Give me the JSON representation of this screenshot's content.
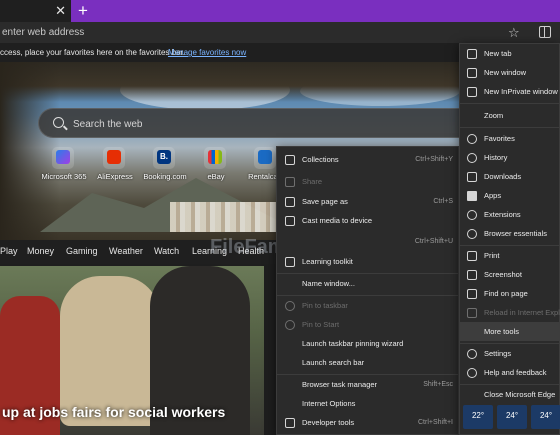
{
  "tabstrip": {
    "close_glyph": "✕",
    "newtab_glyph": "+"
  },
  "address": {
    "text": "enter web address"
  },
  "favbar": {
    "message": "ccess, place your favorites here on the favorites bar.",
    "link": "Manage favorites now"
  },
  "search": {
    "placeholder": "Search the web"
  },
  "quicklinks": [
    {
      "label": "Microsoft 365",
      "icon": "microsoft365-icon",
      "color": "#5a4bd1"
    },
    {
      "label": "AliExpress",
      "icon": "aliexpress-icon",
      "color": "#e62e04"
    },
    {
      "label": "Booking.com",
      "icon": "booking-icon",
      "color": "#003580"
    },
    {
      "label": "eBay",
      "icon": "ebay-icon",
      "color": "#e53238"
    },
    {
      "label": "Rentalcars",
      "icon": "rentalcars-icon",
      "color": "#1b6bc4"
    }
  ],
  "quicklink_glyphs": [
    "",
    "",
    "B.",
    "",
    ""
  ],
  "categories": [
    "Play",
    "Money",
    "Gaming",
    "Weather",
    "Watch",
    "Learning",
    "Health"
  ],
  "news": {
    "headline": "up at jobs fairs for social workers"
  },
  "watermark": "FileFamous",
  "main_menu": {
    "items": [
      {
        "label": "New tab",
        "icon": "new-tab-icon"
      },
      {
        "label": "New window",
        "icon": "new-window-icon"
      },
      {
        "label": "New InPrivate window",
        "icon": "inprivate-icon"
      },
      {
        "label": "Zoom",
        "icon": ""
      },
      {
        "label": "Favorites",
        "icon": "favorites-icon"
      },
      {
        "label": "History",
        "icon": "history-icon"
      },
      {
        "label": "Downloads",
        "icon": "downloads-icon"
      },
      {
        "label": "Apps",
        "icon": "apps-icon"
      },
      {
        "label": "Extensions",
        "icon": "extensions-icon"
      },
      {
        "label": "Browser essentials",
        "icon": "browser-essentials-icon"
      },
      {
        "label": "Print",
        "icon": "print-icon"
      },
      {
        "label": "Screenshot",
        "icon": "screenshot-icon"
      },
      {
        "label": "Find on page",
        "icon": "find-icon"
      },
      {
        "label": "Reload in Internet Explorer mode",
        "icon": "ie-mode-icon"
      },
      {
        "label": "More tools",
        "icon": ""
      },
      {
        "label": "Settings",
        "icon": "settings-icon"
      },
      {
        "label": "Help and feedback",
        "icon": "help-icon"
      },
      {
        "label": "Close Microsoft Edge",
        "icon": ""
      }
    ]
  },
  "more_tools": {
    "items": [
      {
        "label": "Collections",
        "shortcut": "Ctrl+Shift+Y",
        "icon": "collections-icon"
      },
      {
        "label": "Share",
        "shortcut": "",
        "icon": "share-icon"
      },
      {
        "label": "Save page as",
        "shortcut": "Ctrl+S",
        "icon": "save-icon"
      },
      {
        "label": "Cast media to device",
        "shortcut": "",
        "icon": "cast-icon"
      },
      {
        "label": "",
        "shortcut": "Ctrl+Shift+U",
        "icon": ""
      },
      {
        "label": "Learning toolkit",
        "shortcut": "",
        "icon": "learning-toolkit-icon"
      },
      {
        "label": "Name window...",
        "shortcut": "",
        "icon": ""
      },
      {
        "label": "Pin to taskbar",
        "shortcut": "",
        "icon": "pin-icon"
      },
      {
        "label": "Pin to Start",
        "shortcut": "",
        "icon": "pin-start-icon"
      },
      {
        "label": "Launch taskbar pinning wizard",
        "shortcut": "",
        "icon": ""
      },
      {
        "label": "Launch search bar",
        "shortcut": "",
        "icon": ""
      },
      {
        "label": "Browser task manager",
        "shortcut": "Shift+Esc",
        "icon": ""
      },
      {
        "label": "Internet Options",
        "shortcut": "",
        "icon": ""
      },
      {
        "label": "Developer tools",
        "shortcut": "Ctrl+Shift+I",
        "icon": "developer-tools-icon"
      }
    ]
  },
  "weather": [
    "22°",
    "24°",
    "24°"
  ],
  "colors": {
    "accent_tabstrip": "#7a2fbf",
    "menu_bg": "#2b2b2b",
    "link": "#7ab4ff"
  }
}
